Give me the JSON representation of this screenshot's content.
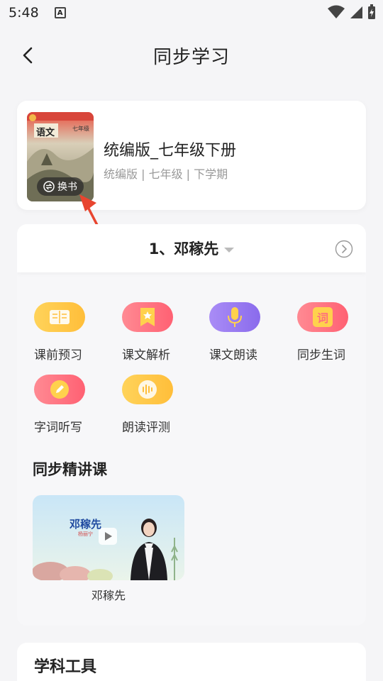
{
  "status_bar": {
    "time": "5:48",
    "notification_icon": "A"
  },
  "nav": {
    "title": "同步学习"
  },
  "book": {
    "title": "统编版_七年级下册",
    "meta": "统编版 | 七年级 | 下学期",
    "cover_text": "语文",
    "cover_side_text": "七年级",
    "swap_label": "换书"
  },
  "lesson": {
    "name": "1、邓稼先"
  },
  "functions": [
    {
      "label": "课前预习",
      "icon": "book-icon",
      "color": "#ffc43d"
    },
    {
      "label": "课文解析",
      "icon": "star-bookmark-icon",
      "color": "#ff6f7d"
    },
    {
      "label": "课文朗读",
      "icon": "microphone-icon",
      "color": "#9a7cf2"
    },
    {
      "label": "同步生词",
      "icon": "word-icon",
      "color": "#ff6f7d",
      "icon_text": "词"
    },
    {
      "label": "字词听写",
      "icon": "pencil-icon",
      "color": "#ff6f7d"
    },
    {
      "label": "朗读评测",
      "icon": "soundwave-icon",
      "color": "#ffc43d"
    }
  ],
  "course_section": {
    "title": "同步精讲课"
  },
  "course": {
    "thumb_title": "邓稼先",
    "thumb_subtitle": "杨丽宁",
    "caption": "邓稼先"
  },
  "tools": {
    "title": "学科工具"
  }
}
